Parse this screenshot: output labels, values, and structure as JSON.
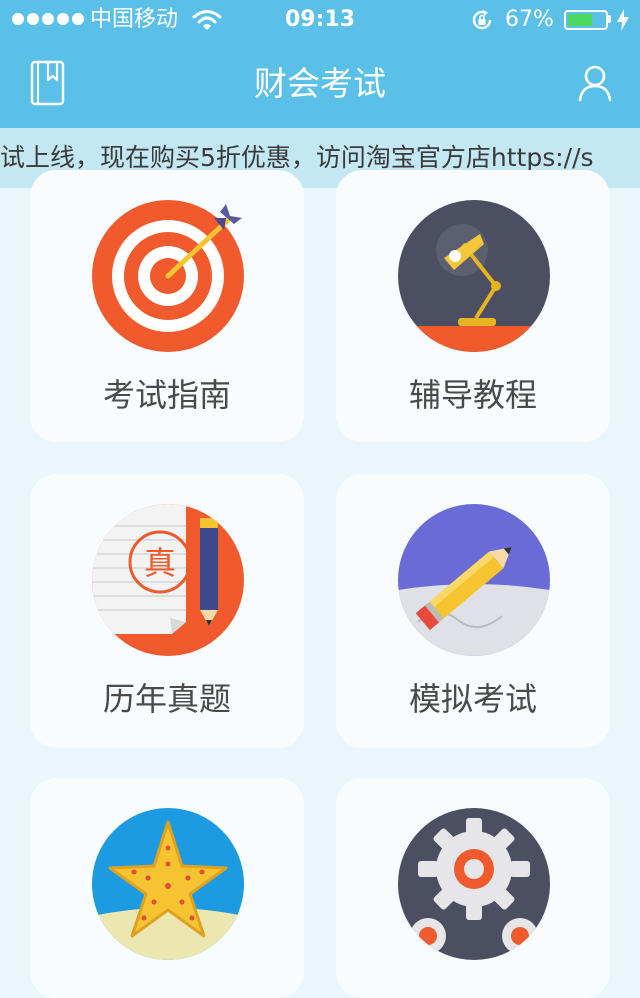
{
  "status_bar": {
    "carrier": "中国移动",
    "time": "09:13",
    "battery_percent": "67%",
    "battery_level": 0.67,
    "signal_dots": 5
  },
  "nav": {
    "title": "财会考试",
    "left_icon": "bookmark-icon",
    "right_icon": "user-icon"
  },
  "notice": {
    "text": "试上线，现在购买5折优惠，访问淘宝官方店https://s"
  },
  "menu": [
    {
      "label": "考试指南",
      "icon": "target-icon"
    },
    {
      "label": "辅导教程",
      "icon": "desk-lamp-icon"
    },
    {
      "label": "历年真题",
      "icon": "exam-paper-icon"
    },
    {
      "label": "模拟考试",
      "icon": "pencil-icon"
    },
    {
      "label": "",
      "icon": "starfish-icon"
    },
    {
      "label": "",
      "icon": "gear-icon"
    }
  ],
  "colors": {
    "header": "#5bc0e8",
    "notice_bg": "#c3e8f4",
    "page_bg": "#eaf6fb",
    "card_bg": "#f8fcfe",
    "battery": "#4cd964"
  }
}
